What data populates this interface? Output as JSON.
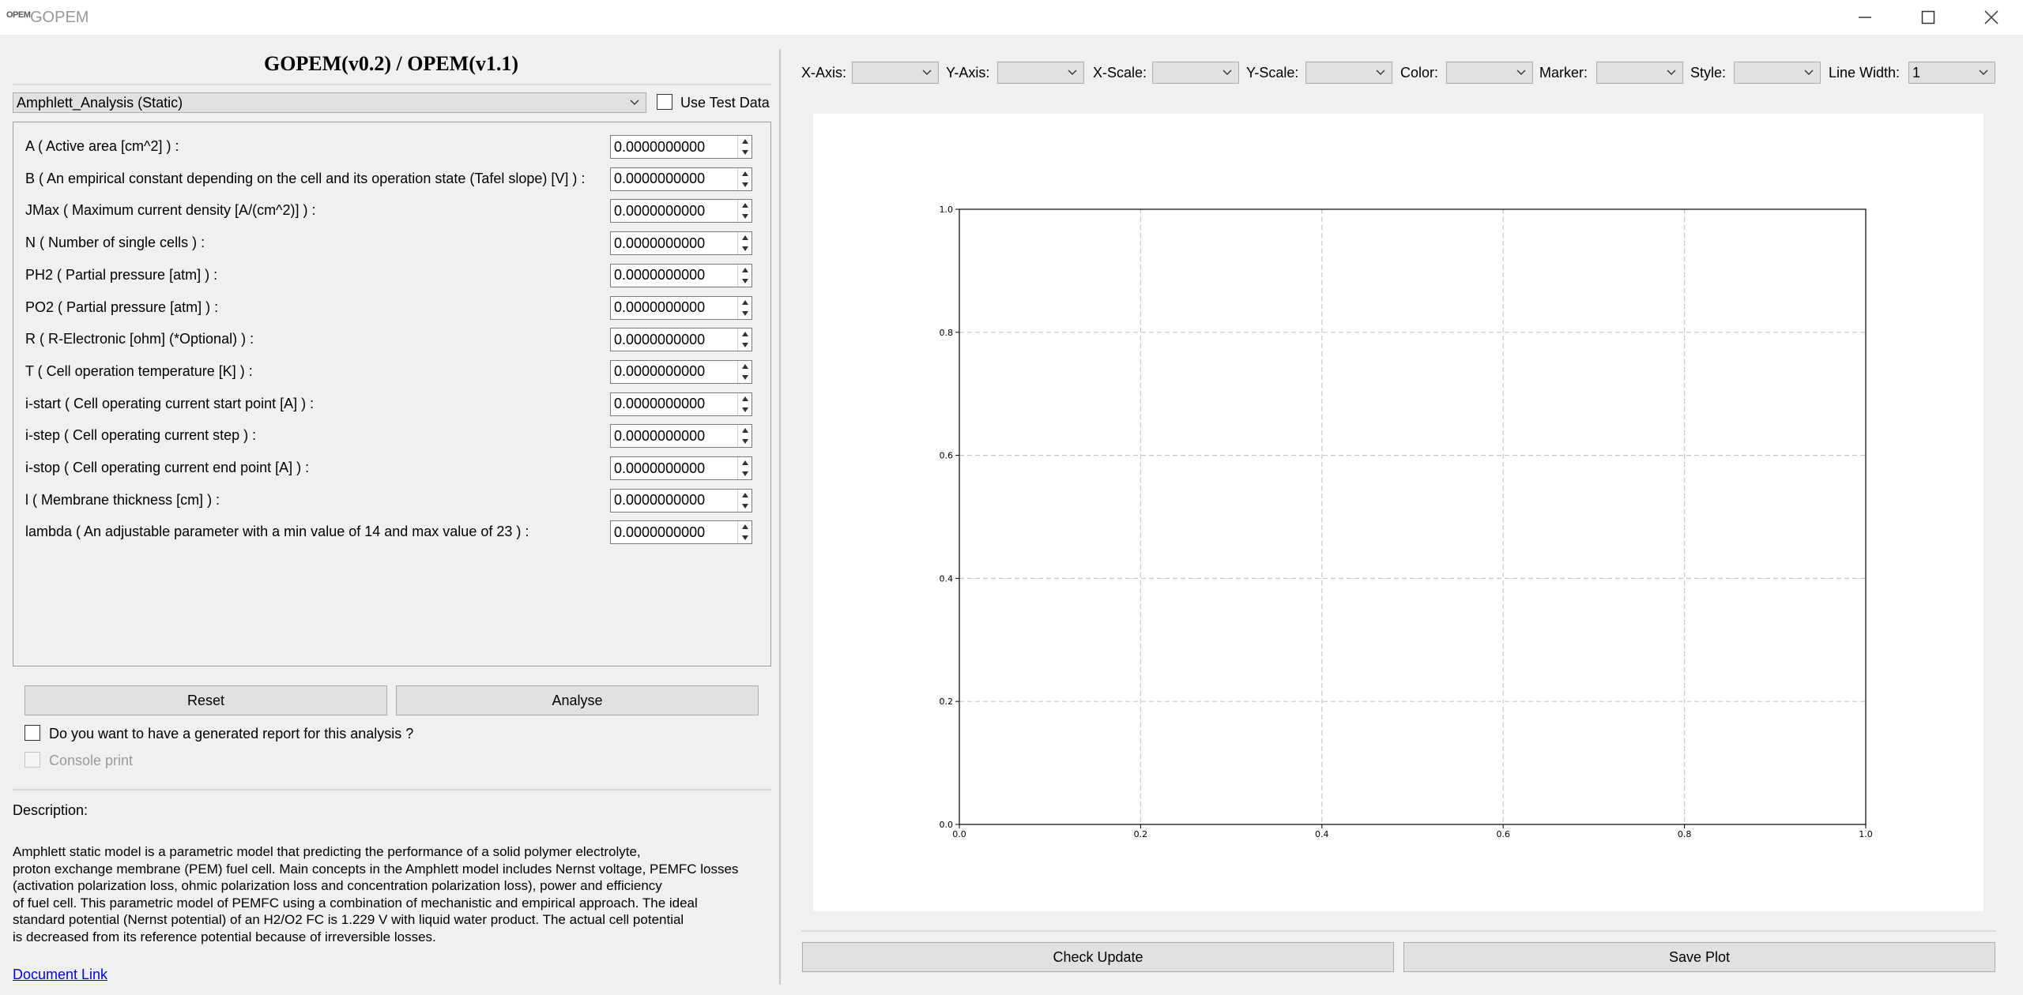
{
  "window": {
    "logo_text": "OPEM",
    "title": "GOPEM",
    "icons": {
      "minimize": "minimize-icon",
      "maximize": "maximize-icon",
      "close": "close-icon"
    }
  },
  "header": {
    "title": "GOPEM(v0.2) / OPEM(v1.1)"
  },
  "model_select": {
    "value": "Amphlett_Analysis (Static)"
  },
  "use_test_data": {
    "label": "Use Test Data",
    "checked": false
  },
  "params": [
    {
      "label": "A ( Active area [cm^2] ) :",
      "value": "0.0000000000"
    },
    {
      "label": "B ( An empirical constant depending on the cell and its operation state (Tafel slope) [V] ) :",
      "value": "0.0000000000"
    },
    {
      "label": "JMax ( Maximum current density [A/(cm^2)] ) :",
      "value": "0.0000000000"
    },
    {
      "label": "N ( Number of single cells ) :",
      "value": "0.0000000000"
    },
    {
      "label": "PH2 ( Partial pressure [atm] ) :",
      "value": "0.0000000000"
    },
    {
      "label": "PO2 ( Partial pressure [atm] ) :",
      "value": "0.0000000000"
    },
    {
      "label": "R ( R-Electronic [ohm] (*Optional) ) :",
      "value": "0.0000000000"
    },
    {
      "label": "T ( Cell operation temperature [K] ) :",
      "value": "0.0000000000"
    },
    {
      "label": "i-start ( Cell operating current start point [A] ) :",
      "value": "0.0000000000"
    },
    {
      "label": "i-step ( Cell operating current step ) :",
      "value": "0.0000000000"
    },
    {
      "label": "i-stop ( Cell operating current end point [A] ) :",
      "value": "0.0000000000"
    },
    {
      "label": "l ( Membrane thickness [cm] ) :",
      "value": "0.0000000000"
    },
    {
      "label": "lambda ( An adjustable parameter with a min value of 14 and max value of 23 ) :",
      "value": "0.0000000000"
    }
  ],
  "actions": {
    "reset_label": "Reset",
    "analyse_label": "Analyse"
  },
  "report_option": {
    "label": "Do you want to have a generated report for this analysis ?",
    "checked": false
  },
  "console_option": {
    "label": "Console print",
    "enabled": false
  },
  "description": {
    "title": "Description:",
    "text": "Amphlett static model is a parametric model that predicting the performance of a solid polymer electrolyte,\nproton exchange membrane (PEM) fuel cell. Main concepts in the Amphlett model includes Nernst voltage, PEMFC losses\n(activation polarization loss, ohmic polarization loss and concentration polarization loss), power and efficiency\nof fuel cell. This parametric model of PEMFC using a combination of mechanistic and empirical approach. The ideal\nstandard potential (Nernst potential) of an H2/O2 FC is 1.229 V with liquid water product. The actual cell potential\nis decreased from its reference potential because of irreversible losses.",
    "link_label": "Document Link"
  },
  "plot_toolbar": {
    "x_axis_label": "X-Axis:",
    "x_axis_value": "",
    "y_axis_label": "Y-Axis:",
    "y_axis_value": "",
    "x_scale_label": "X-Scale:",
    "x_scale_value": "",
    "y_scale_label": "Y-Scale:",
    "y_scale_value": "",
    "color_label": "Color:",
    "color_value": "",
    "marker_label": "Marker:",
    "marker_value": "",
    "style_label": "Style:",
    "style_value": "",
    "line_width_label": "Line Width:",
    "line_width_value": "1"
  },
  "chart_data": {
    "type": "line",
    "title": "",
    "xlabel": "",
    "ylabel": "",
    "series": [],
    "xlim": [
      0.0,
      1.0
    ],
    "ylim": [
      0.0,
      1.0
    ],
    "x_ticks": [
      "0.0",
      "0.2",
      "0.4",
      "0.6",
      "0.8",
      "1.0"
    ],
    "y_ticks": [
      "0.0",
      "0.2",
      "0.4",
      "0.6",
      "0.8",
      "1.0"
    ],
    "grid": true
  },
  "bottom_actions": {
    "check_update_label": "Check Update",
    "save_plot_label": "Save Plot"
  }
}
